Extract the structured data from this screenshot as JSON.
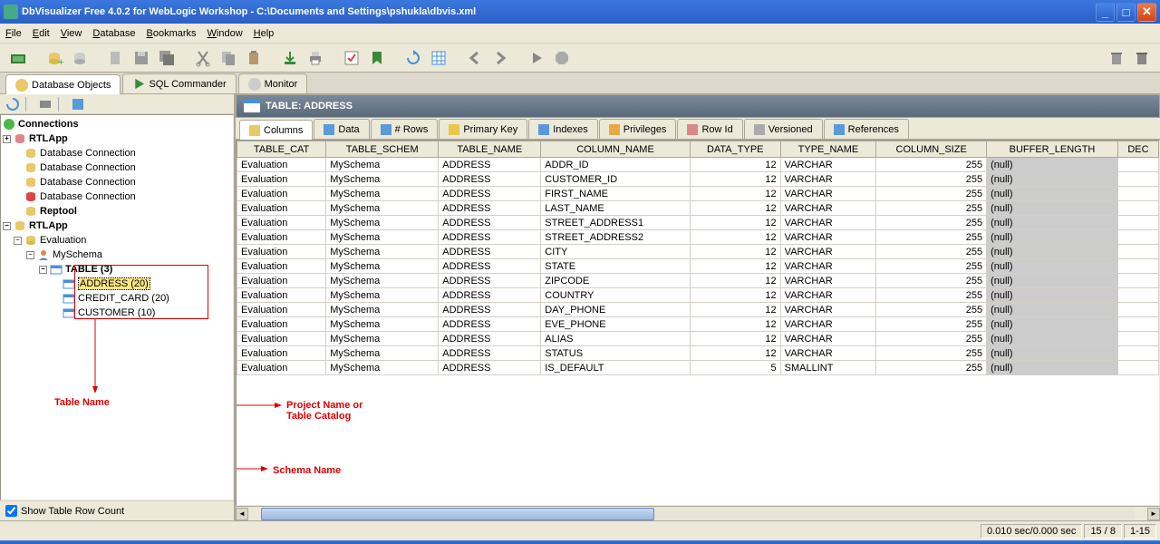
{
  "window": {
    "title": "DbVisualizer Free 4.0.2 for WebLogic Workshop - C:\\Documents and Settings\\pshukla\\dbvis.xml"
  },
  "menu": {
    "file": "File",
    "edit": "Edit",
    "view": "View",
    "database": "Database",
    "bookmarks": "Bookmarks",
    "window": "Window",
    "help": "Help"
  },
  "main_tabs": {
    "db_objects": "Database Objects",
    "sql_commander": "SQL Commander",
    "monitor": "Monitor"
  },
  "tree": {
    "root": "Connections",
    "items": [
      "RTLApp",
      "Database Connection",
      "Database Connection",
      "Database Connection",
      "Database Connection",
      "Reptool",
      "RTLApp"
    ],
    "evaluation": "Evaluation",
    "schema": "MySchema",
    "table_node": "TABLE (3)",
    "tables": {
      "address": "ADDRESS (20)",
      "credit_card": "CREDIT_CARD (20)",
      "customer": "CUSTOMER (10)"
    }
  },
  "annotations": {
    "table_name": "Table Name",
    "project_name": "Project Name or\nTable Catalog",
    "schema_name": "Schema Name"
  },
  "rp": {
    "title": "TABLE: ADDRESS",
    "tabs": {
      "columns": "Columns",
      "data": "Data",
      "rows": "# Rows",
      "pk": "Primary Key",
      "indexes": "Indexes",
      "privileges": "Privileges",
      "rowid": "Row Id",
      "versioned": "Versioned",
      "references": "References"
    }
  },
  "grid": {
    "headers": [
      "TABLE_CAT",
      "TABLE_SCHEM",
      "TABLE_NAME",
      "COLUMN_NAME",
      "DATA_TYPE",
      "TYPE_NAME",
      "COLUMN_SIZE",
      "BUFFER_LENGTH",
      "DEC"
    ],
    "rows": [
      [
        "Evaluation",
        "MySchema",
        "ADDRESS",
        "ADDR_ID",
        "12",
        "VARCHAR",
        "255",
        "(null)",
        ""
      ],
      [
        "Evaluation",
        "MySchema",
        "ADDRESS",
        "CUSTOMER_ID",
        "12",
        "VARCHAR",
        "255",
        "(null)",
        ""
      ],
      [
        "Evaluation",
        "MySchema",
        "ADDRESS",
        "FIRST_NAME",
        "12",
        "VARCHAR",
        "255",
        "(null)",
        ""
      ],
      [
        "Evaluation",
        "MySchema",
        "ADDRESS",
        "LAST_NAME",
        "12",
        "VARCHAR",
        "255",
        "(null)",
        ""
      ],
      [
        "Evaluation",
        "MySchema",
        "ADDRESS",
        "STREET_ADDRESS1",
        "12",
        "VARCHAR",
        "255",
        "(null)",
        ""
      ],
      [
        "Evaluation",
        "MySchema",
        "ADDRESS",
        "STREET_ADDRESS2",
        "12",
        "VARCHAR",
        "255",
        "(null)",
        ""
      ],
      [
        "Evaluation",
        "MySchema",
        "ADDRESS",
        "CITY",
        "12",
        "VARCHAR",
        "255",
        "(null)",
        ""
      ],
      [
        "Evaluation",
        "MySchema",
        "ADDRESS",
        "STATE",
        "12",
        "VARCHAR",
        "255",
        "(null)",
        ""
      ],
      [
        "Evaluation",
        "MySchema",
        "ADDRESS",
        "ZIPCODE",
        "12",
        "VARCHAR",
        "255",
        "(null)",
        ""
      ],
      [
        "Evaluation",
        "MySchema",
        "ADDRESS",
        "COUNTRY",
        "12",
        "VARCHAR",
        "255",
        "(null)",
        ""
      ],
      [
        "Evaluation",
        "MySchema",
        "ADDRESS",
        "DAY_PHONE",
        "12",
        "VARCHAR",
        "255",
        "(null)",
        ""
      ],
      [
        "Evaluation",
        "MySchema",
        "ADDRESS",
        "EVE_PHONE",
        "12",
        "VARCHAR",
        "255",
        "(null)",
        ""
      ],
      [
        "Evaluation",
        "MySchema",
        "ADDRESS",
        "ALIAS",
        "12",
        "VARCHAR",
        "255",
        "(null)",
        ""
      ],
      [
        "Evaluation",
        "MySchema",
        "ADDRESS",
        "STATUS",
        "12",
        "VARCHAR",
        "255",
        "(null)",
        ""
      ],
      [
        "Evaluation",
        "MySchema",
        "ADDRESS",
        "IS_DEFAULT",
        "5",
        "SMALLINT",
        "255",
        "(null)",
        ""
      ]
    ]
  },
  "bottom": {
    "show_row_count": "Show Table Row Count"
  },
  "status": {
    "time": "0.010 sec/0.000 sec",
    "cols": "15 /   8",
    "range": "1-15"
  }
}
